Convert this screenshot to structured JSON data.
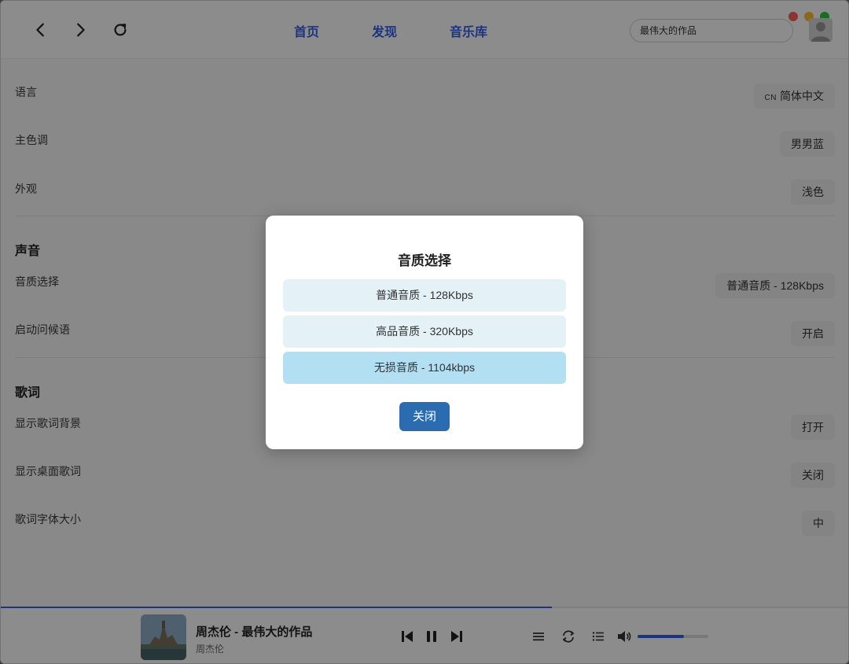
{
  "window_controls": {
    "colors": [
      "#ff5f57",
      "#febc2e",
      "#28c840"
    ]
  },
  "nav": {
    "tabs": [
      {
        "label": "首页"
      },
      {
        "label": "发现"
      },
      {
        "label": "音乐库"
      }
    ],
    "search_value": "最伟大的作品",
    "accent_color": "#335eea"
  },
  "settings": {
    "rows": [
      {
        "label": "语言",
        "value": "简体中文",
        "prefix": "CN"
      },
      {
        "label": "主色调",
        "value": "男男蓝"
      },
      {
        "label": "外观",
        "value": "浅色"
      }
    ],
    "sound": {
      "title": "声音",
      "rows": [
        {
          "label": "音质选择",
          "value": "普通音质 - 128Kbps"
        },
        {
          "label": "启动问候语",
          "value": "开启"
        }
      ]
    },
    "lyrics": {
      "title": "歌词",
      "rows": [
        {
          "label": "显示歌词背景",
          "value": "打开"
        },
        {
          "label": "显示桌面歌词",
          "value": "关闭"
        },
        {
          "label": "歌词字体大小",
          "value": "中"
        }
      ]
    }
  },
  "player": {
    "title": "周杰伦 - 最伟大的作品",
    "artist": "周杰伦",
    "volume": 0.65,
    "progress": 0.65
  },
  "modal": {
    "title": "音质选择",
    "options": [
      {
        "label": "普通音质 - 128Kbps",
        "selected": false
      },
      {
        "label": "高品音质 - 320Kbps",
        "selected": false
      },
      {
        "label": "无损音质 - 1104kbps",
        "selected": true
      }
    ],
    "close_label": "关闭"
  }
}
